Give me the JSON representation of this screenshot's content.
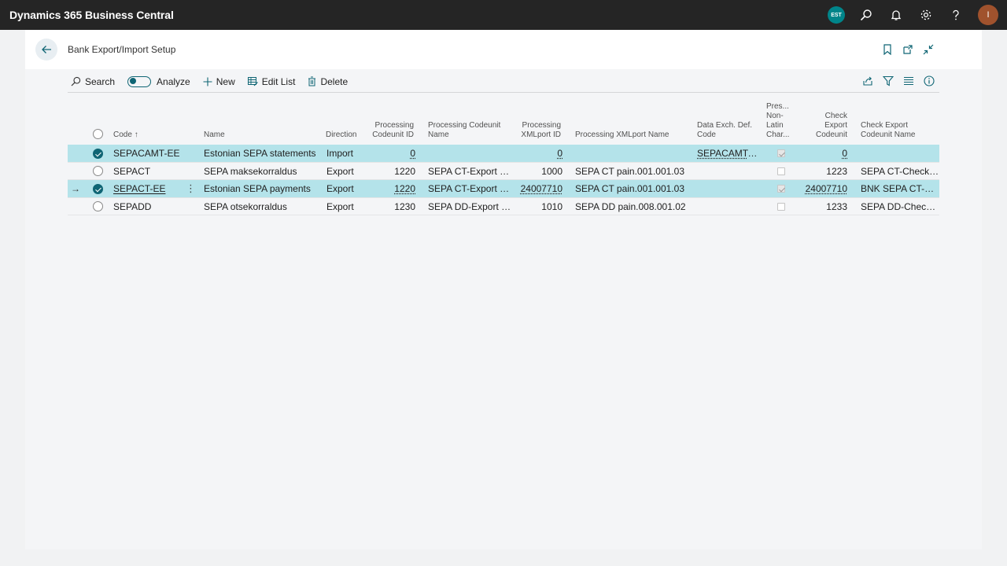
{
  "app": {
    "title": "Dynamics 365 Business Central",
    "company_badge": "EST",
    "user_initial": "I",
    "icons": [
      "search-icon",
      "bell-icon",
      "gear-icon",
      "help-icon"
    ]
  },
  "page": {
    "title": "Bank Export/Import Setup"
  },
  "actions": {
    "search": "Search",
    "analyze": "Analyze",
    "new": "New",
    "edit_list": "Edit List",
    "delete": "Delete"
  },
  "columns": {
    "code": "Code",
    "code_sort": "↑",
    "name": "Name",
    "direction": "Direction",
    "proc_codeunit_id_1": "Processing",
    "proc_codeunit_id_2": "Codeunit ID",
    "proc_codeunit_name_1": "Processing Codeunit",
    "proc_codeunit_name_2": "Name",
    "proc_xmlport_id_1": "Processing",
    "proc_xmlport_id_2": "XMLport ID",
    "proc_xmlport_name": "Processing XMLport Name",
    "data_exch_1": "Data Exch. Def.",
    "data_exch_2": "Code",
    "pres_1": "Pres...",
    "pres_2": "Non-",
    "pres_3": "Latin",
    "pres_4": "Char...",
    "check_export_1": "Check",
    "check_export_2": "Export",
    "check_export_3": "Codeunit",
    "check_export_name_1": "Check Export",
    "check_export_name_2": "Codeunit Name"
  },
  "rows": [
    {
      "code": "SEPACAMT-EE",
      "name": "Estonian SEPA statements",
      "direction": "Import",
      "proc_codeunit_id": "0",
      "proc_codeunit_name": "",
      "proc_xmlport_id": "0",
      "proc_xmlport_name": "",
      "data_exch_def": "SEPACAMT-EE",
      "preserve_non_latin": true,
      "check_export_codeunit": "0",
      "check_export_name": "",
      "selected": true,
      "current": false
    },
    {
      "code": "SEPACT",
      "name": "SEPA maksekorraldus",
      "direction": "Export",
      "proc_codeunit_id": "1220",
      "proc_codeunit_name": "SEPA CT-Export File",
      "proc_xmlport_id": "1000",
      "proc_xmlport_name": "SEPA CT pain.001.001.03",
      "data_exch_def": "",
      "preserve_non_latin": false,
      "check_export_codeunit": "1223",
      "check_export_name": "SEPA CT-Check Line",
      "selected": false,
      "current": false
    },
    {
      "code": "SEPACT-EE",
      "name": "Estonian SEPA payments",
      "direction": "Export",
      "proc_codeunit_id": "1220",
      "proc_codeunit_name": "SEPA CT-Export File",
      "proc_xmlport_id": "24007710",
      "proc_xmlport_name": "SEPA CT pain.001.001.03",
      "data_exch_def": "",
      "preserve_non_latin": true,
      "check_export_codeunit": "24007710",
      "check_export_name": "BNK SEPA CT-Che...",
      "selected": true,
      "current": true
    },
    {
      "code": "SEPADD",
      "name": "SEPA otsekorraldus",
      "direction": "Export",
      "proc_codeunit_id": "1230",
      "proc_codeunit_name": "SEPA DD-Export File",
      "proc_xmlport_id": "1010",
      "proc_xmlport_name": "SEPA DD pain.008.001.02",
      "data_exch_def": "",
      "preserve_non_latin": false,
      "check_export_codeunit": "1233",
      "check_export_name": "SEPA DD-Check Li...",
      "selected": false,
      "current": false
    }
  ],
  "colors": {
    "appbar": "#252525",
    "accent": "#0f6574",
    "selected_row": "#b4e3ea",
    "company_badge": "#00858a",
    "avatar": "#a0522d"
  }
}
